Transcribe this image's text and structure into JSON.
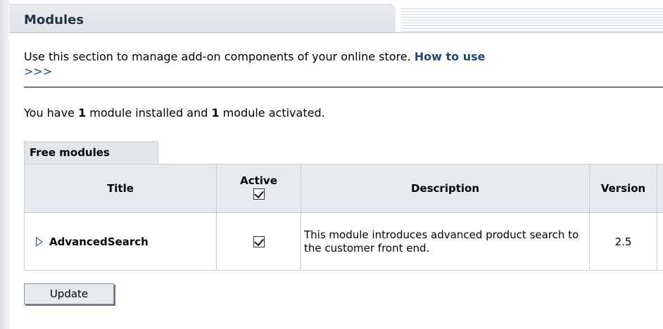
{
  "header": {
    "title": "Modules"
  },
  "intro": {
    "text": "Use this section to manage add-on components of your online store. ",
    "link": "How to use",
    "more": ">>>"
  },
  "status": {
    "prefix": "You have ",
    "installed": "1",
    "middle": " module installed and ",
    "activated": "1",
    "suffix": " module activated."
  },
  "tab": {
    "label": "Free modules"
  },
  "table": {
    "headers": {
      "title": "Title",
      "active": "Active",
      "description": "Description",
      "version": "Version"
    },
    "rows": [
      {
        "title": "AdvancedSearch",
        "active": true,
        "description": "This module introduces advanced product search to the customer front end.",
        "version": "2.5"
      }
    ]
  },
  "buttons": {
    "update": "Update"
  },
  "icons": {
    "expand": "expand-arrow-icon",
    "checkbox": "checkbox-checked-icon"
  }
}
